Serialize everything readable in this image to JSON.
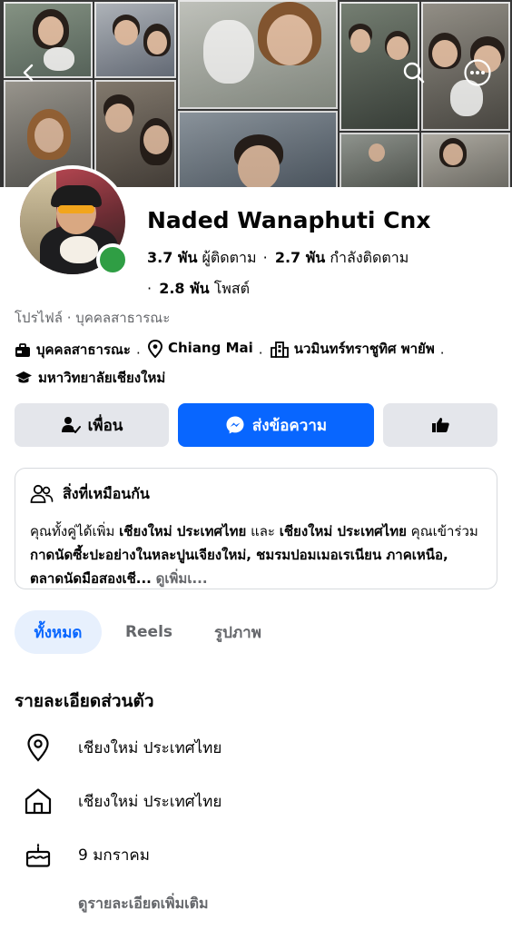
{
  "profile": {
    "name": "Naded Wanaphuti Cnx",
    "followers_count": "3.7 พัน",
    "followers_label": "ผู้ติดตาม",
    "following_count": "2.7 พัน",
    "following_label": "กำลังติดตาม",
    "posts_count": "2.8 พัน",
    "posts_label": "โพสต์",
    "page_type": "โปรไฟล์ · บุคคลสาธารณะ",
    "online_status_color": "#2f9e44"
  },
  "meta": {
    "category": "บุคคลสาธารณะ",
    "location": "Chiang Mai",
    "workplace": "นวมินทร์ทราชูทิศ พายัพ",
    "school": "มหาวิทยาลัยเชียงใหม่"
  },
  "icons": {
    "back": "back-arrow-icon",
    "search": "search-icon",
    "more": "more-options-icon",
    "category": "briefcase-icon",
    "location": "location-pin-icon",
    "workplace": "building-icon",
    "school": "graduation-cap-icon",
    "friends": "friend-check-icon",
    "messenger": "messenger-icon",
    "more_actions": "thumbs-up-icon",
    "mutual": "people-icon",
    "birthday": "cake-icon",
    "home": "home-icon"
  },
  "actions": {
    "friends_label": "เพื่อน",
    "message_label": "ส่งข้อความ"
  },
  "mutual": {
    "title": "สิ่งที่เหมือนกัน",
    "p1": "คุณทั้งคู่ได้เพิ่ม ",
    "b1": "เชียงใหม่ ประเทศไทย",
    "p2": " และ ",
    "b2": "เชียงใหม่ ประเทศไทย",
    "p3": " คุณเข้าร่วม ",
    "b3": "กาดนัดซี้ะปะอย่างในหละปูนเจียงใหม่, ชมรมปอมเมอเรเนียน ภาคเหนือ, ตลาดนัดมือสองเชี...",
    "see_more": "ดูเพิ่มเ..."
  },
  "tabs": [
    {
      "label": "ทั้งหมด"
    },
    {
      "label": "Reels"
    },
    {
      "label": "รูปภาพ"
    }
  ],
  "details": {
    "title": "รายละเอียดส่วนตัว",
    "current_city": "เชียงใหม่ ประเทศไทย",
    "hometown": "เชียงใหม่ ประเทศไทย",
    "birthday": "9 มกราคม",
    "see_details": "ดูรายละเอียดเพิ่มเติม"
  },
  "colors": {
    "accent": "#0866ff",
    "button_gray": "#e4e6eb",
    "secondary_text": "#65676b",
    "tab_active_bg": "#e7f0fd"
  }
}
